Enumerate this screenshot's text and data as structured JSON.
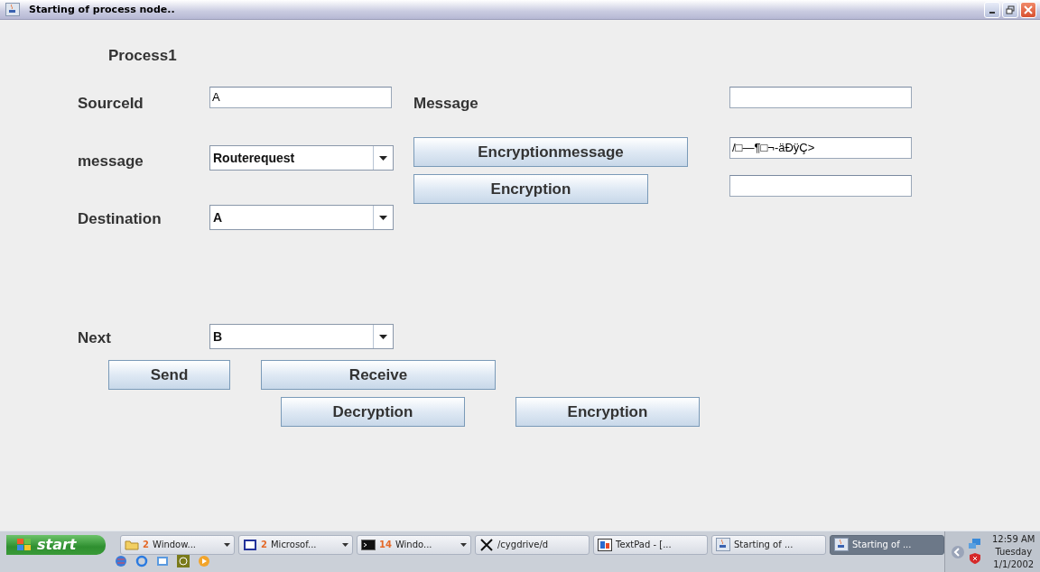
{
  "window": {
    "title": "Starting of process node.."
  },
  "form": {
    "heading": "Process1",
    "source_id": {
      "label": "SourceId",
      "value": "A"
    },
    "message_label": "Message",
    "message_select": {
      "label": "message",
      "value": "Routerequest"
    },
    "encryption_message_button": "Encryptionmessage",
    "encrypted_field": {
      "value": "/□—¶□¬-äÐÿÇ>"
    },
    "encryption_button": "Encryption",
    "destination": {
      "label": "Destination",
      "value": "A"
    },
    "next": {
      "label": "Next",
      "value": "B"
    },
    "send_button": "Send",
    "receive_button": "Receive",
    "decryption_button": "Decryption",
    "encryption_button_2": "Encryption"
  },
  "taskbar": {
    "start": "start",
    "items": [
      {
        "kind": "folder",
        "count": "2",
        "label": "Window...",
        "group": true,
        "selected": false
      },
      {
        "kind": "word",
        "count": "2",
        "label": "Microsof...",
        "group": true,
        "selected": false
      },
      {
        "kind": "console",
        "count": "14",
        "label": "Windo...",
        "group": true,
        "selected": false
      },
      {
        "kind": "x",
        "label": "/cygdrive/d",
        "group": false,
        "selected": false
      },
      {
        "kind": "textpad",
        "label": "TextPad - [...",
        "group": false,
        "selected": false
      },
      {
        "kind": "java",
        "label": "Starting of ...",
        "group": false,
        "selected": false
      },
      {
        "kind": "java",
        "label": "Starting of ...",
        "group": false,
        "selected": true
      }
    ],
    "clock": {
      "time": "12:59 AM",
      "day": "Tuesday",
      "date": "1/1/2002"
    }
  }
}
